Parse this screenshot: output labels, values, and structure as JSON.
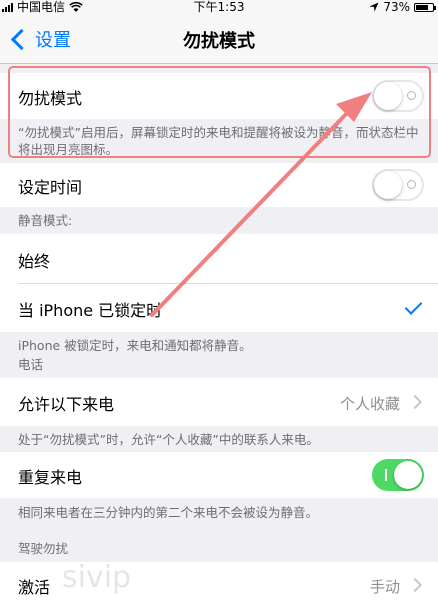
{
  "status_bar": {
    "carrier": "中国电信",
    "time": "下午1:53",
    "battery_percent": "73%",
    "battery_level": 0.73
  },
  "nav": {
    "back_label": "设置",
    "title": "勿扰模式"
  },
  "rows": {
    "dnd": {
      "label": "勿扰模式",
      "toggle_on": false
    },
    "dnd_footer": "“勿扰模式”启用后，屏幕锁定时的来电和提醒将被设为静音，而状态栏中将出现月亮图标。",
    "scheduled": {
      "label": "设定时间",
      "toggle_on": false
    },
    "silence_header": "静音模式:",
    "always": {
      "label": "始终"
    },
    "locked": {
      "label": "当 iPhone 已锁定时",
      "checked": true
    },
    "silence_footer": "iPhone 被锁定时，来电和通知都将静音。",
    "phone_header": "电话",
    "allow_calls": {
      "label": "允许以下来电",
      "value": "个人收藏"
    },
    "allow_footer": "处于“勿扰模式”时，允许“个人收藏”中的联系人来电。",
    "repeated": {
      "label": "重复来电",
      "toggle_on": true
    },
    "repeated_footer": "相同来电者在三分钟内的第二个来电不会被设为静音。",
    "driving_header": "驾驶勿扰",
    "activate": {
      "label": "激活",
      "value": "手动"
    }
  },
  "overlay": {
    "watermark": "sivip",
    "annotation_color": "#f08080"
  }
}
